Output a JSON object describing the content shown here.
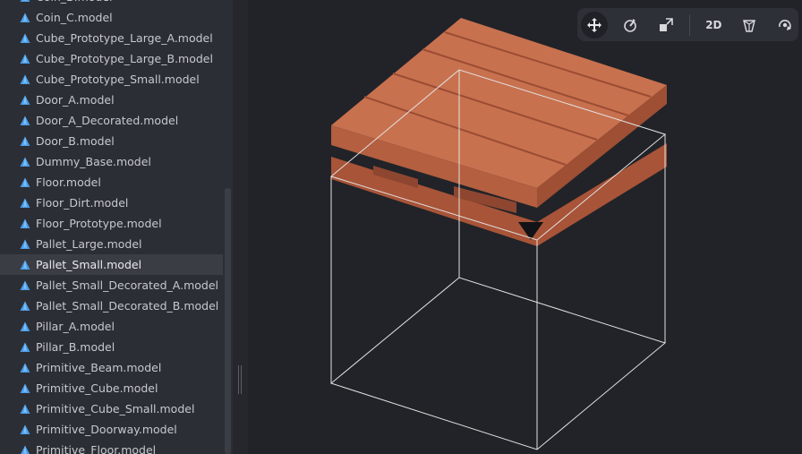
{
  "asset_browser": {
    "selected_index": 13,
    "items": [
      {
        "label": "Coin_B.model"
      },
      {
        "label": "Coin_C.model"
      },
      {
        "label": "Cube_Prototype_Large_A.model"
      },
      {
        "label": "Cube_Prototype_Large_B.model"
      },
      {
        "label": "Cube_Prototype_Small.model"
      },
      {
        "label": "Door_A.model"
      },
      {
        "label": "Door_A_Decorated.model"
      },
      {
        "label": "Door_B.model"
      },
      {
        "label": "Dummy_Base.model"
      },
      {
        "label": "Floor.model"
      },
      {
        "label": "Floor_Dirt.model"
      },
      {
        "label": "Floor_Prototype.model"
      },
      {
        "label": "Pallet_Large.model"
      },
      {
        "label": "Pallet_Small.model"
      },
      {
        "label": "Pallet_Small_Decorated_A.model"
      },
      {
        "label": "Pallet_Small_Decorated_B.model"
      },
      {
        "label": "Pillar_A.model"
      },
      {
        "label": "Pillar_B.model"
      },
      {
        "label": "Primitive_Beam.model"
      },
      {
        "label": "Primitive_Cube.model"
      },
      {
        "label": "Primitive_Cube_Small.model"
      },
      {
        "label": "Primitive_Doorway.model"
      },
      {
        "label": "Primitive_Floor.model"
      }
    ]
  },
  "toolbar": {
    "mode_2d_label": "2D",
    "icons": [
      "move-icon",
      "rotate-icon",
      "scale-icon",
      "perspective-icon",
      "orbit-camera-icon"
    ]
  },
  "colors": {
    "model_icon": "#4a9be6",
    "pallet_top": "#c8714f",
    "pallet_side": "#a85438",
    "bounds_box": "#e2e2e2"
  }
}
